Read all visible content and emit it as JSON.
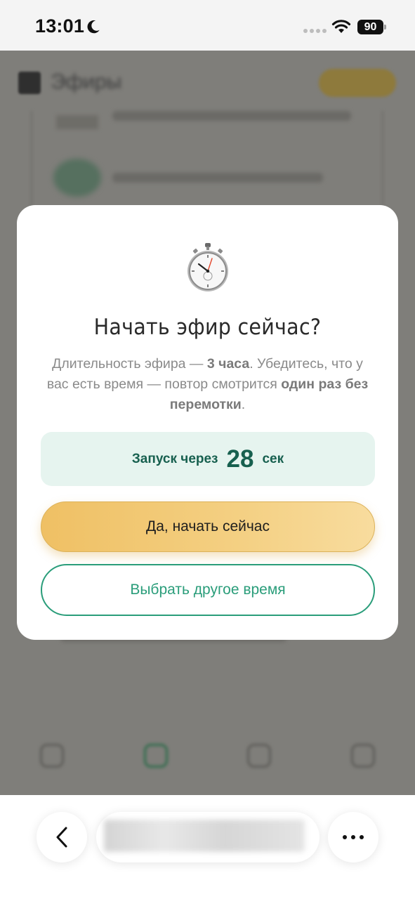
{
  "status_bar": {
    "time": "13:01",
    "battery": "90",
    "icons": [
      "moon-icon",
      "signal-dots-icon",
      "wifi-icon",
      "battery-icon"
    ]
  },
  "background_app": {
    "header_title": "Эфиры",
    "obscured": true
  },
  "modal": {
    "icon": "stopwatch-icon",
    "title": "Начать эфир сейчас?",
    "description": {
      "part1": "Длительность эфира — ",
      "bold1": "3 часа",
      "part2": ". Убедитесь, что у вас есть время — повтор смотрится ",
      "bold2": "один раз без перемотки",
      "part3": "."
    },
    "countdown": {
      "prefix": "Запуск через",
      "seconds": "28",
      "suffix": "сек"
    },
    "confirm_label": "Да, начать сейчас",
    "alt_label": "Выбрать другое время"
  },
  "browser_bar": {
    "back_icon": "chevron-left-icon",
    "more_icon": "more-dots-icon"
  },
  "colors": {
    "accent_green": "#2a9d7a",
    "countdown_bg": "#e6f4ef",
    "countdown_text": "#17604f",
    "gold_start": "#efc064",
    "gold_end": "#f8dc9e"
  }
}
